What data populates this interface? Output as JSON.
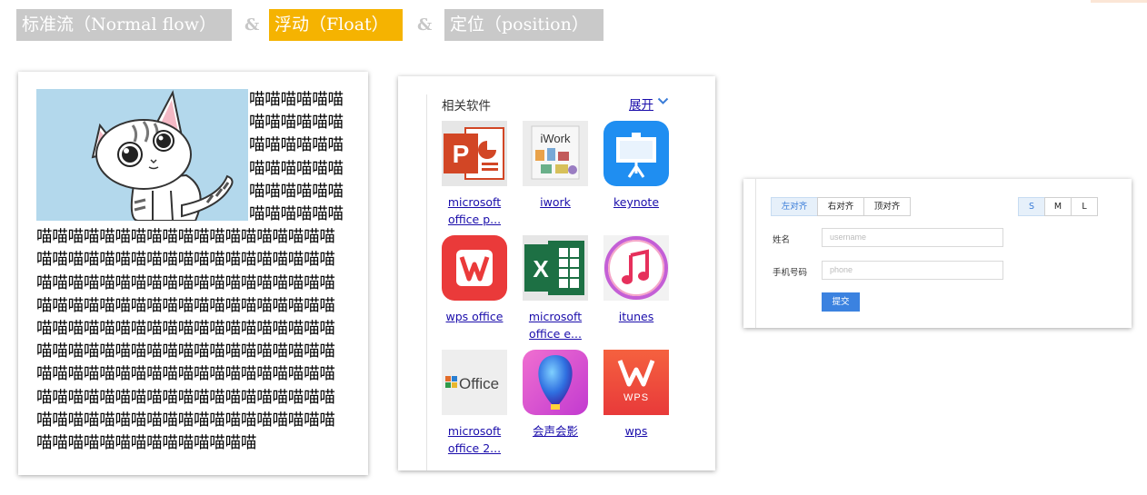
{
  "header": {
    "normal_flow": "标准流（Normal flow）",
    "amp": "&",
    "float": "浮动（Float）",
    "position": "定位（position）"
  },
  "flow_demo": {
    "image": "cat-illustration",
    "text": "喵喵喵喵喵喵喵喵喵喵喵喵喵喵喵喵喵喵喵喵喵喵喵喵喵喵喵喵喵喵喵喵喵喵喵喵喵喵喵喵喵喵喵喵喵喵喵喵喵喵喵喵喵喵喵喵喵喵喵喵喵喵喵喵喵喵喵喵喵喵喵喵喵喵喵喵喵喵喵喵喵喵喵喵喵喵喵喵喵喵喵喵喵喵喵喵喵喵喵喵喵喵喵喵喵喵喵喵喵喵喵喵喵喵喵喵喵喵喵喵喵喵喵喵喵喵喵喵喵喵喵喵喵喵喵喵喵喵喵喵喵喵喵喵喵喵喵喵喵喵喵喵喵喵喵喵喵喵喵喵喵喵喵喵喵喵喵喵喵喵喵喵喵喵喵喵喵喵喵喵喵喵喵喵喵喵喵喵喵喵喵喵喵喵喵喵喵喵喵喵喵喵喵喵喵喵喵喵喵喵喵喵喵喵喵喵喵喵喵喵喵"
  },
  "related_software": {
    "title": "相关软件",
    "expand_label": "展开",
    "expand_icon": "chevron-down-icon",
    "apps": [
      {
        "icon": "powerpoint-icon",
        "label": "microsoft office p...",
        "color": "#d24625"
      },
      {
        "icon": "iwork-icon",
        "label": "iwork",
        "color": "#eaeaea"
      },
      {
        "icon": "keynote-icon",
        "label": "keynote",
        "color": "#1f8ef1"
      },
      {
        "icon": "wps-office-icon",
        "label": "wps office",
        "color": "#ea3a3a"
      },
      {
        "icon": "excel-icon",
        "label": "microsoft office e...",
        "color": "#1d7044"
      },
      {
        "icon": "itunes-icon",
        "label": "itunes",
        "color": "#f3f3f3"
      },
      {
        "icon": "office-2011-icon",
        "label": "microsoft office 2...",
        "color": "#eeeeee"
      },
      {
        "icon": "huishenghuiying-icon",
        "label": "会声会影",
        "color": "#e04fc9"
      },
      {
        "icon": "wps-icon",
        "label": "wps",
        "color": "#ef4b3a"
      }
    ]
  },
  "form": {
    "align_buttons": [
      "左对齐",
      "右对齐",
      "顶对齐"
    ],
    "align_active": 0,
    "size_buttons": [
      "S",
      "M",
      "L"
    ],
    "size_active": 0,
    "name_label": "姓名",
    "name_placeholder": "username",
    "phone_label": "手机号码",
    "phone_placeholder": "phone",
    "submit_label": "提交",
    "accent": "#3b82e0"
  }
}
